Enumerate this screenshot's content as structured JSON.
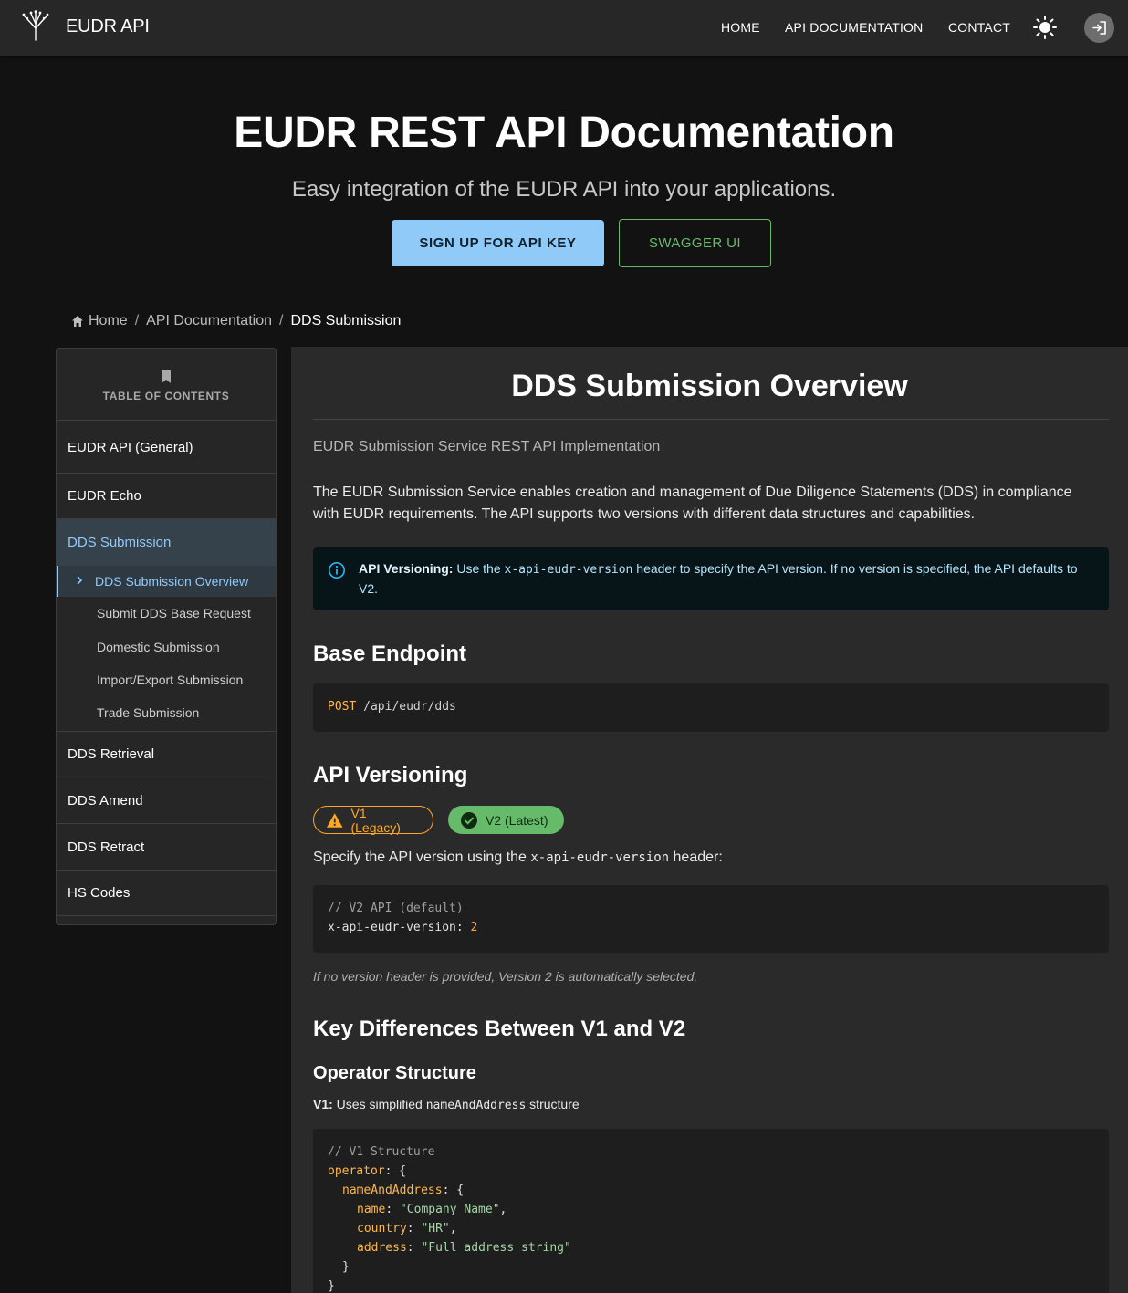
{
  "header": {
    "brand": "EUDR API",
    "nav": [
      "HOME",
      "API DOCUMENTATION",
      "CONTACT"
    ],
    "theme_icon": "sun-icon",
    "login_icon": "login-icon"
  },
  "hero": {
    "title": "EUDR REST API Documentation",
    "subtitle": "Easy integration of the EUDR API into your applications.",
    "primary_button": "SIGN UP FOR API KEY",
    "secondary_button": "SWAGGER UI"
  },
  "breadcrumb": {
    "items": [
      "Home",
      "API Documentation"
    ],
    "current": "DDS Submission"
  },
  "toc": {
    "heading": "TABLE OF CONTENTS",
    "items": [
      "EUDR API (General)",
      "EUDR Echo",
      "DDS Submission",
      "DDS Retrieval",
      "DDS Amend",
      "DDS Retract",
      "HS Codes"
    ],
    "subitems": [
      "DDS Submission Overview",
      "Submit DDS Base Request",
      "Domestic Submission",
      "Import/Export Submission",
      "Trade Submission"
    ]
  },
  "content": {
    "title": "DDS Submission Overview",
    "subtitle": "EUDR Submission Service REST API Implementation",
    "intro": "The EUDR Submission Service enables creation and management of Due Diligence Statements (DDS) in compliance with EUDR requirements. The API supports two versions with different data structures and capabilities.",
    "alert": {
      "label": "API Versioning:",
      "text_before": " Use the ",
      "code": "x-api-eudr-version",
      "text_after": " header to specify the API version. If no version is specified, the API defaults to V2."
    },
    "base_endpoint": {
      "heading": "Base Endpoint",
      "method": "POST",
      "path": "/api/eudr/dds"
    },
    "versioning": {
      "heading": "API Versioning",
      "chip_v1": "V1 (Legacy)",
      "chip_v2": "V2 (Latest)",
      "text_before": "Specify the API version using the ",
      "code": "x-api-eudr-version",
      "text_after": " header:",
      "code_comment": "// V2 API (default)",
      "code_key": "x-api-eudr-version:",
      "code_value": "2",
      "note": "If no version header is provided, Version 2 is automatically selected."
    },
    "differences": {
      "heading": "Key Differences Between V1 and V2",
      "subheading": "Operator Structure",
      "v1_label": "V1:",
      "v1_text_before": " Uses simplified ",
      "v1_code": "nameAndAddress",
      "v1_text_after": " structure",
      "code": {
        "comment": "// V1 Structure",
        "operator": "operator",
        "nameAndAddress": "nameAndAddress",
        "name_key": "name",
        "name_val": "\"Company Name\"",
        "country_key": "country",
        "country_val": "\"HR\"",
        "address_key": "address",
        "address_val": "\"Full address string\""
      }
    }
  },
  "colors": {
    "accent": "#90caf9",
    "success": "#66bb6a",
    "warning": "#ffa726"
  }
}
